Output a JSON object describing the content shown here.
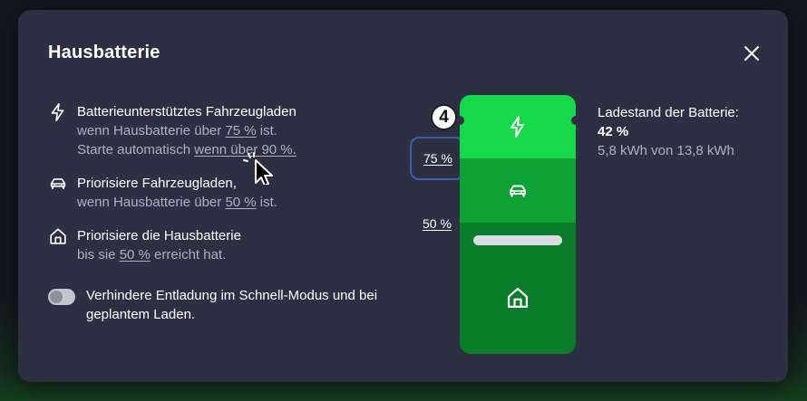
{
  "modal": {
    "title": "Hausbatterie",
    "close_icon": "close-icon"
  },
  "rules": [
    {
      "icon": "bolt-icon",
      "title": "Batterieunterstütztes Fahrzeugladen",
      "line2_prefix": "wenn Hausbatterie über ",
      "line2_link": "75 %",
      "line2_suffix": " ist.",
      "line3_prefix": "Starte automatisch ",
      "line3_link": "wenn über 90 %."
    },
    {
      "icon": "car-icon",
      "title": "Priorisiere Fahrzeugladen,",
      "line2_prefix": "wenn Hausbatterie über ",
      "line2_link": "50 %",
      "line2_suffix": " ist."
    },
    {
      "icon": "home-icon",
      "title": "Priorisiere die Hausbatterie",
      "line2_prefix": "bis sie ",
      "line2_link": "50 %",
      "line2_suffix": " erreicht hat."
    }
  ],
  "toggle": {
    "label": "Verhindere Entladung im Schnell-Modus und bei geplantem Laden.",
    "enabled": false
  },
  "battery": {
    "step_badge": "4",
    "threshold_high": "75 %",
    "threshold_low": "50 %",
    "segment_colors": [
      "#16d949",
      "#0ea236",
      "#0a7c2a"
    ]
  },
  "status": {
    "label": "Ladestand der Batterie:",
    "percent": "42 %",
    "energy": "5,8 kWh von 13,8 kWh"
  },
  "colors": {
    "modal_bg": "#2d3042",
    "muted_text": "#aeb1bd",
    "highlight": "#3b5fa8"
  }
}
